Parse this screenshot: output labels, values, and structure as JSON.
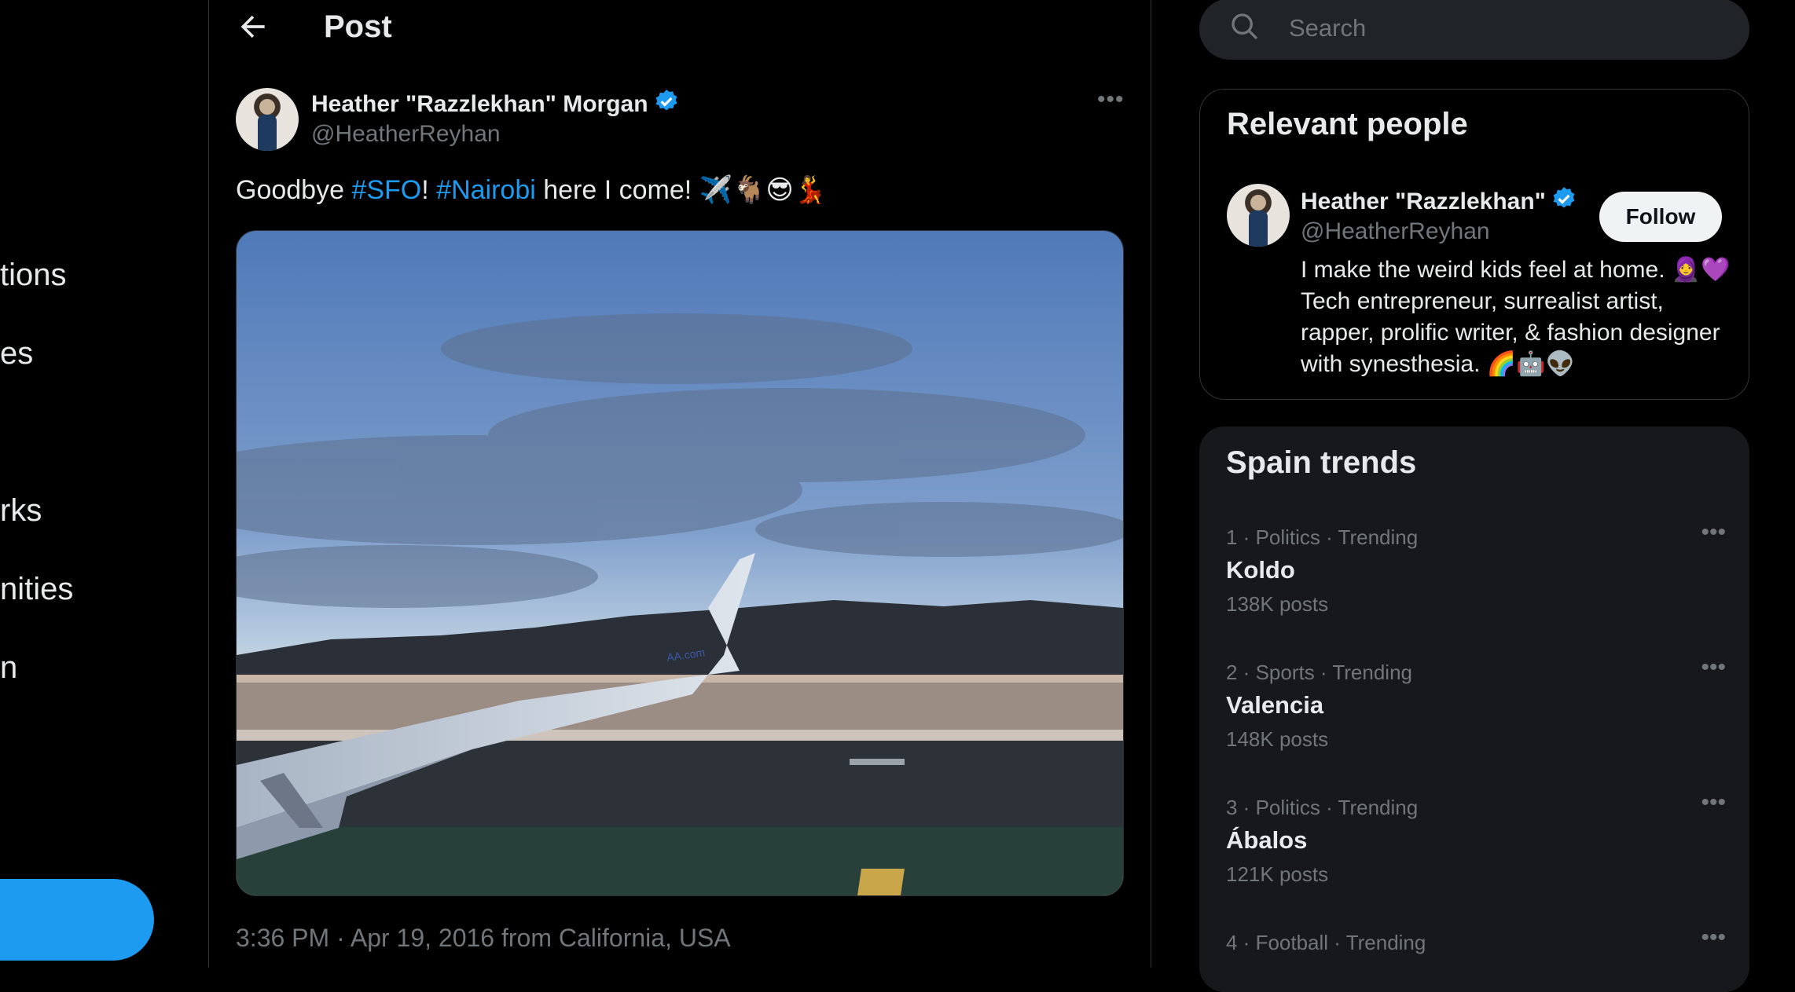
{
  "left_nav": {
    "items": [
      "tions",
      "es",
      "rks",
      "nities",
      "n"
    ]
  },
  "header": {
    "title": "Post"
  },
  "post": {
    "display_name": "Heather \"Razzlekhan\" Morgan",
    "handle": "@HeatherReyhan",
    "text_prefix": "Goodbye ",
    "hashtag1": "#SFO",
    "text_mid": "! ",
    "hashtag2": "#Nairobi",
    "text_suffix": " here I come! ✈️🐐😎💃",
    "meta": "3:36 PM · Apr 19, 2016 from California, USA",
    "more": "•••"
  },
  "search": {
    "placeholder": "Search"
  },
  "relevant_people": {
    "title": "Relevant people",
    "name": "Heather \"Razzlekhan\"",
    "handle": "@HeatherReyhan",
    "follow_label": "Follow",
    "bio": "I make the weird kids feel at home. 🧕💜 Tech entrepreneur, surrealist artist, rapper, prolific writer, & fashion designer with synesthesia. 🌈🤖👽"
  },
  "trends": {
    "title": "Spain trends",
    "items": [
      {
        "meta": "1 · Politics · Trending",
        "name": "Koldo",
        "count": "138K posts"
      },
      {
        "meta": "2 · Sports · Trending",
        "name": "Valencia",
        "count": "148K posts"
      },
      {
        "meta": "3 · Politics · Trending",
        "name": "Ábalos",
        "count": "121K posts"
      },
      {
        "meta": "4 · Football · Trending",
        "name": "",
        "count": ""
      }
    ],
    "more": "•••"
  },
  "colors": {
    "accent": "#1d9bf0",
    "background": "#000000",
    "muted": "#71767b"
  }
}
